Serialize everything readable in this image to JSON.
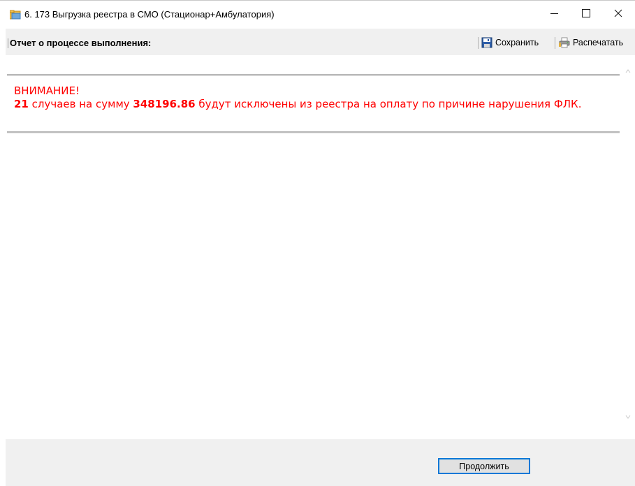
{
  "window": {
    "title": "6. 173 Выгрузка реестра в СМО (Стационар+Амбулатория)",
    "app_icon": "folder-icon",
    "controls": {
      "minimize_icon": "minimize-icon",
      "maximize_icon": "maximize-icon",
      "close_glyph": "✕"
    }
  },
  "toolbar": {
    "report_title": "Отчет о процессе выполнения:",
    "save_label": "Сохранить",
    "save_icon": "floppy-disk-icon",
    "print_label": "Распечатать",
    "print_icon": "printer-icon"
  },
  "content": {
    "warning_heading": "ВНИМАНИЕ!",
    "case_count": "21",
    "text_part1": " случаев на сумму ",
    "amount": "348196.86",
    "text_part2": " будут исключены из реестра на оплату по причине нарушения ФЛК.",
    "warning_color": "#ff0000"
  },
  "footer": {
    "continue_label": "Продолжить"
  }
}
